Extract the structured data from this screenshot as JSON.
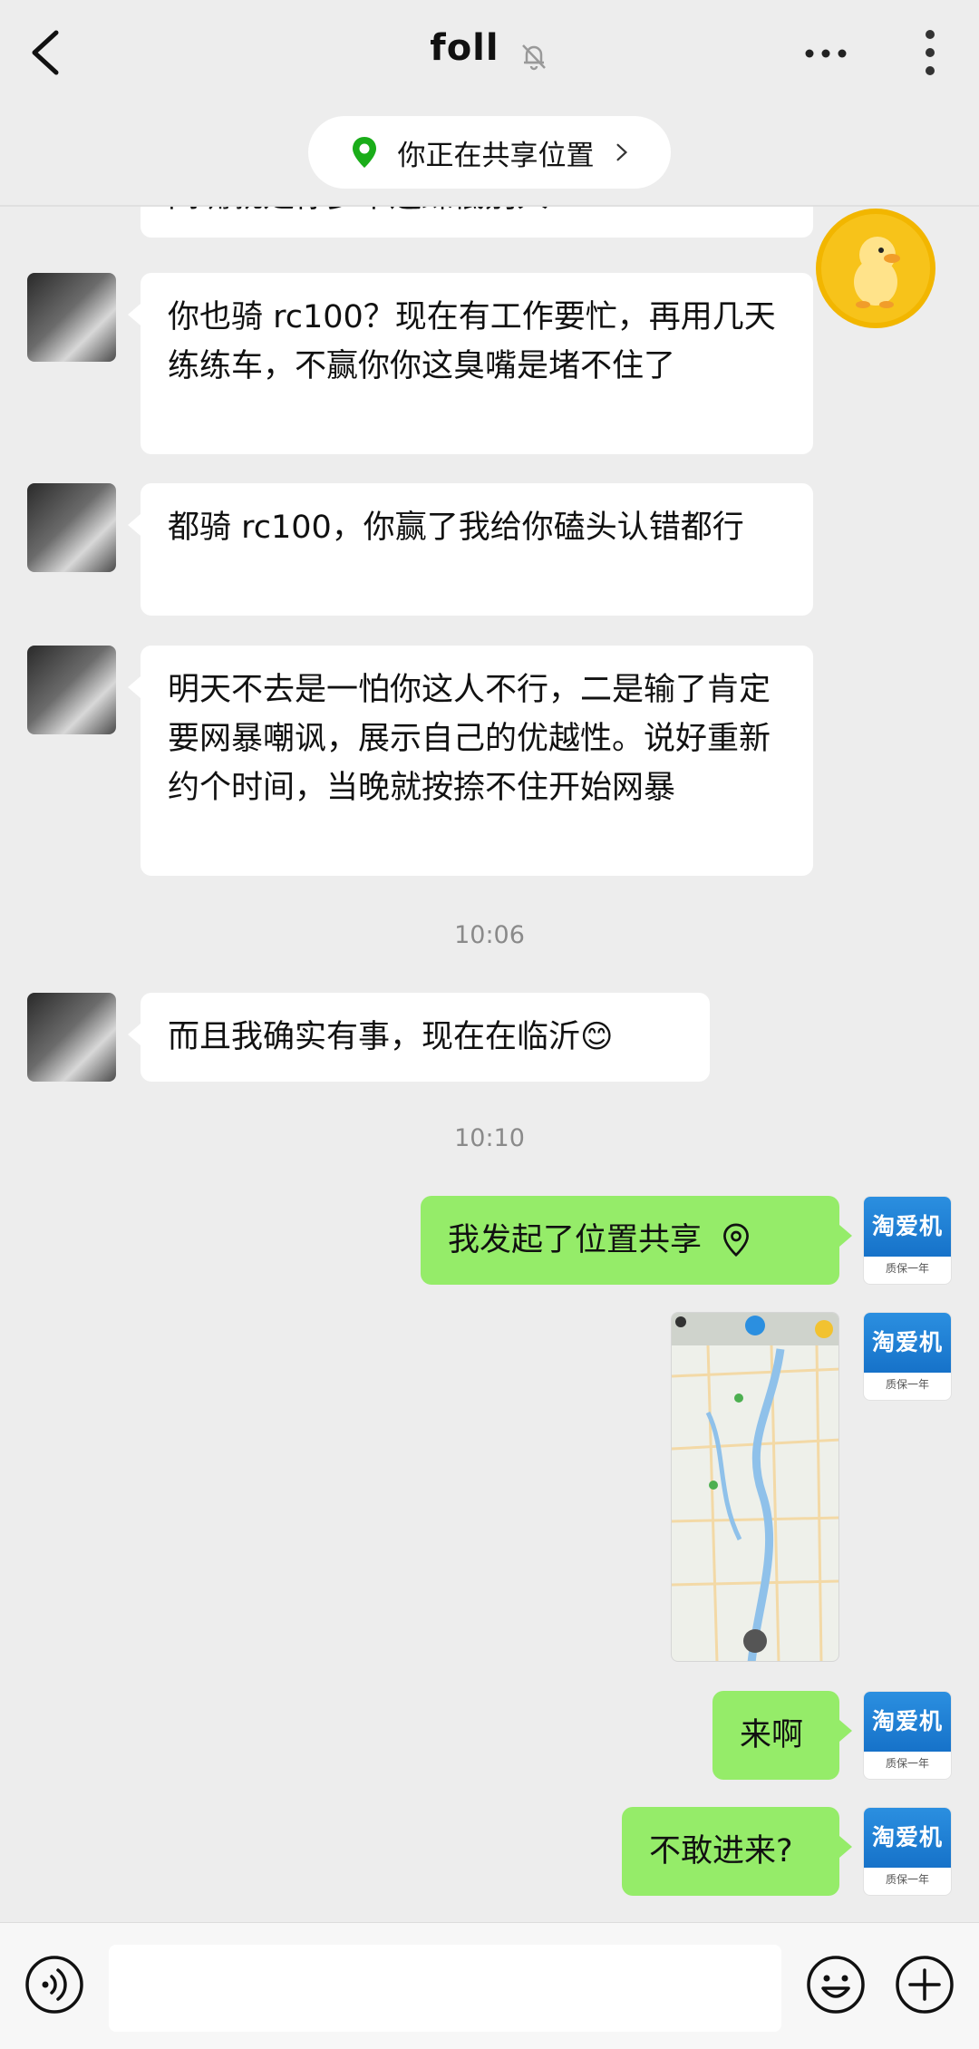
{
  "header": {
    "title": "foll",
    "back_icon": "chevron-left-icon",
    "mute_icon": "bell-off-icon",
    "more_icon": "more-horizontal-icon",
    "menu_icon": "more-vertical-icon"
  },
  "share_banner": {
    "text": "你正在共享位置",
    "icon": "location-pin-icon",
    "accent": "#1aad19"
  },
  "messages": [
    {
      "side": "left",
      "text": "闭嘴就是你多半遛躁低别人"
    },
    {
      "side": "left",
      "text": "你也骑 rc100？现在有工作要忙，再用几天练练车，不赢你你这臭嘴是堵不住了"
    },
    {
      "side": "left",
      "text": "都骑 rc100，你赢了我给你磕头认错都行"
    },
    {
      "side": "left",
      "text": "明天不去是一怕你这人不行，二是输了肯定要网暴嘲讽，展示自己的优越性。说好重新约个时间，当晚就按捺不住开始网暴"
    },
    {
      "type": "time",
      "text": "10:06"
    },
    {
      "side": "left",
      "text": "而且我确实有事，现在在临沂😊"
    },
    {
      "type": "time",
      "text": "10:10"
    },
    {
      "side": "right",
      "text": "我发起了位置共享",
      "icon": "location-outline-icon"
    },
    {
      "side": "right",
      "type": "image",
      "content": "map-screenshot"
    },
    {
      "side": "right",
      "text": "来啊"
    },
    {
      "side": "right",
      "text": "不敢进来?"
    }
  ],
  "my_avatar": {
    "brand": "淘爱机",
    "tagline": "质保一年"
  },
  "bottom_bar": {
    "voice_icon": "voice-icon",
    "emoji_icon": "emoji-icon",
    "plus_icon": "plus-circle-icon"
  },
  "colors": {
    "background": "#ededed",
    "bubble_self": "#95ec69",
    "bubble_other": "#ffffff"
  }
}
